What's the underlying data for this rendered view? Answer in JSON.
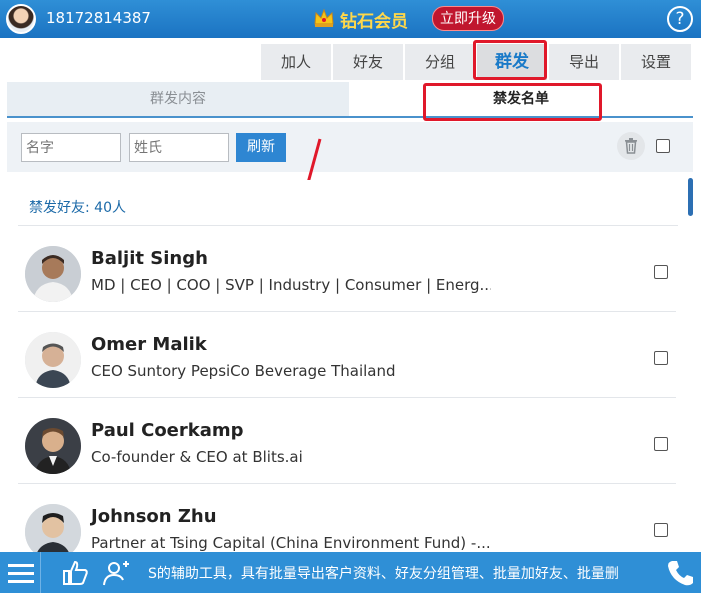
{
  "header": {
    "phone": "18172814387",
    "vip_label": "钻石会员",
    "upgrade_label": "立即升级",
    "help_label": "?"
  },
  "top_tabs": [
    {
      "label": "加人"
    },
    {
      "label": "好友"
    },
    {
      "label": "分组"
    },
    {
      "label": "群发",
      "active": true
    },
    {
      "label": "导出"
    },
    {
      "label": "设置"
    }
  ],
  "sub_tabs": [
    {
      "label": "群发内容"
    },
    {
      "label": "禁发名单",
      "active": true
    }
  ],
  "filter": {
    "first_name_placeholder": "名字",
    "last_name_placeholder": "姓氏",
    "refresh_label": "刷新"
  },
  "list": {
    "count_label": "禁发好友: 40人",
    "items": [
      {
        "name": "Baljit Singh",
        "title": "MD | CEO | COO | SVP | Industry | Consumer | Energ..."
      },
      {
        "name": "Omer Malik",
        "title": "CEO Suntory PepsiCo Beverage Thailand"
      },
      {
        "name": "Paul Coerkamp",
        "title": "Co-founder & CEO at Blits.ai"
      },
      {
        "name": "Johnson Zhu",
        "title": "Partner at Tsing Capital (China Environment Fund) -..."
      }
    ]
  },
  "bottom_bar": {
    "marquee": "S的辅助工具，具有批量导出客户资料、好友分组管理、批量加好友、批量删"
  },
  "colors": {
    "primary": "#2f8fd6",
    "accent_red": "#e0182a",
    "vip_gold": "#ffd84a"
  }
}
